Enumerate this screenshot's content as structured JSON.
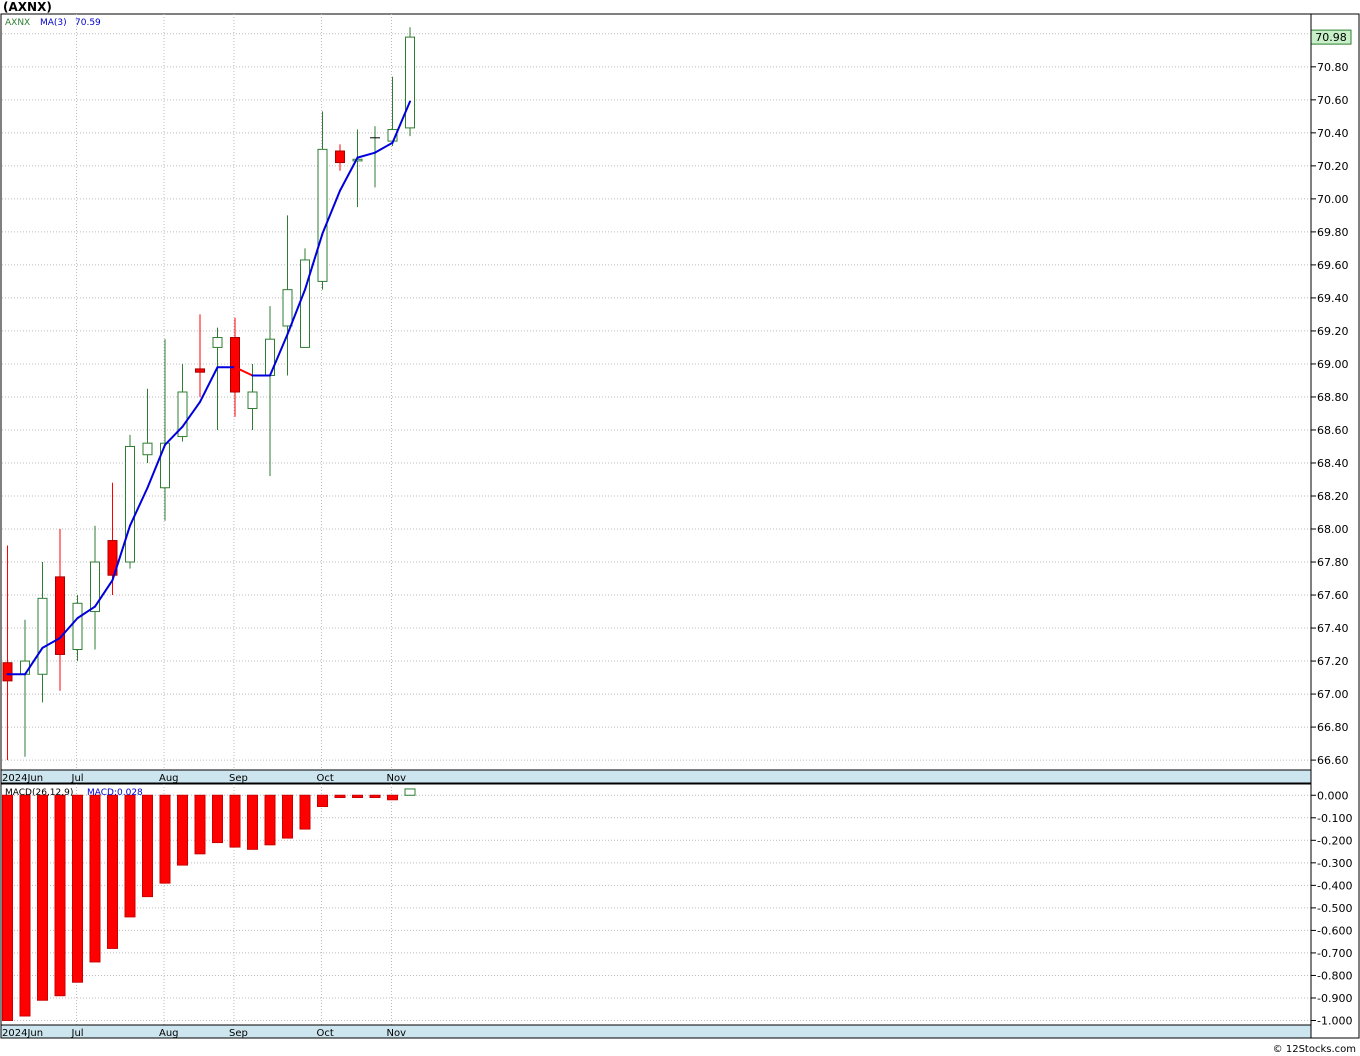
{
  "page": {
    "title": "(AXNX)",
    "footer": "© 12Stocks.com"
  },
  "colors": {
    "up_candle": "#2e7d32",
    "down_candle": "#ff0000",
    "ma_up": "#0000dd",
    "ma_down": "#ff0000",
    "date_band": "#cde5ee",
    "price_tag": "#c8f0c8",
    "macd_neg": "#ff0000",
    "macd_pos": "#2e7d32"
  },
  "chart_data": {
    "type": "candlestick",
    "price_panel": {
      "legend": {
        "symbol": "AXNX",
        "ma_label": "MA(3)",
        "ma_value": "70.59"
      },
      "last_price": "70.98",
      "ylim": [
        66.54,
        71.12
      ],
      "y_ticks": [
        "71.00",
        "70.80",
        "70.60",
        "70.40",
        "70.20",
        "70.00",
        "69.80",
        "69.60",
        "69.40",
        "69.20",
        "69.00",
        "68.80",
        "68.60",
        "68.40",
        "68.20",
        "68.00",
        "67.80",
        "67.60",
        "67.40",
        "67.20",
        "67.00",
        "66.80",
        "66.60"
      ],
      "x_labels": [
        {
          "label": "2024Jun",
          "index": 0
        },
        {
          "label": "Jul",
          "index": 4
        },
        {
          "label": "Aug",
          "index": 9
        },
        {
          "label": "Sep",
          "index": 13
        },
        {
          "label": "Oct",
          "index": 18
        },
        {
          "label": "Nov",
          "index": 22
        }
      ],
      "candles": [
        {
          "o": 67.19,
          "h": 67.9,
          "l": 66.6,
          "c": 67.08
        },
        {
          "o": 67.12,
          "h": 67.45,
          "l": 66.62,
          "c": 67.2
        },
        {
          "o": 67.12,
          "h": 67.8,
          "l": 66.95,
          "c": 67.58
        },
        {
          "o": 67.71,
          "h": 68.0,
          "l": 67.02,
          "c": 67.24
        },
        {
          "o": 67.27,
          "h": 67.6,
          "l": 67.2,
          "c": 67.55
        },
        {
          "o": 67.5,
          "h": 68.02,
          "l": 67.27,
          "c": 67.8
        },
        {
          "o": 67.93,
          "h": 68.28,
          "l": 67.6,
          "c": 67.72
        },
        {
          "o": 67.8,
          "h": 68.57,
          "l": 67.76,
          "c": 68.5
        },
        {
          "o": 68.45,
          "h": 68.85,
          "l": 68.4,
          "c": 68.52
        },
        {
          "o": 68.25,
          "h": 69.15,
          "l": 68.05,
          "c": 68.52
        },
        {
          "o": 68.56,
          "h": 69.0,
          "l": 68.53,
          "c": 68.83
        },
        {
          "o": 68.97,
          "h": 69.3,
          "l": 68.8,
          "c": 68.95
        },
        {
          "o": 69.1,
          "h": 69.22,
          "l": 68.6,
          "c": 69.16
        },
        {
          "o": 69.16,
          "h": 69.28,
          "l": 68.68,
          "c": 68.83
        },
        {
          "o": 68.73,
          "h": 69.0,
          "l": 68.6,
          "c": 68.83
        },
        {
          "o": 68.93,
          "h": 69.35,
          "l": 68.32,
          "c": 69.15
        },
        {
          "o": 69.23,
          "h": 69.9,
          "l": 68.93,
          "c": 69.45
        },
        {
          "o": 69.1,
          "h": 69.7,
          "l": 69.1,
          "c": 69.63
        },
        {
          "o": 69.5,
          "h": 70.53,
          "l": 69.45,
          "c": 70.3
        },
        {
          "o": 70.29,
          "h": 70.33,
          "l": 70.17,
          "c": 70.22
        },
        {
          "o": 70.23,
          "h": 70.42,
          "l": 69.95,
          "c": 70.24
        },
        {
          "o": 70.37,
          "h": 70.44,
          "l": 70.07,
          "c": 70.37
        },
        {
          "o": 70.35,
          "h": 70.74,
          "l": 70.32,
          "c": 70.42
        },
        {
          "o": 70.43,
          "h": 71.04,
          "l": 70.38,
          "c": 70.98
        }
      ],
      "ma3": [
        67.12,
        67.12,
        67.28,
        67.34,
        67.46,
        67.53,
        67.69,
        68.02,
        68.25,
        68.51,
        68.62,
        68.77,
        68.98,
        68.98,
        68.93,
        68.93,
        69.18,
        69.45,
        69.79,
        70.05,
        70.25,
        70.28,
        70.34,
        70.59
      ]
    },
    "macd_panel": {
      "label": "MACD(26,12,9)",
      "value_label": "MACD:0.028",
      "ylim": [
        -1.02,
        0.05
      ],
      "y_ticks": [
        "0.000",
        "-0.100",
        "-0.200",
        "-0.300",
        "-0.400",
        "-0.500",
        "-0.600",
        "-0.700",
        "-0.800",
        "-0.900",
        "-1.000"
      ],
      "x_labels": [
        {
          "label": "2024Jun",
          "index": 0
        },
        {
          "label": "Jul",
          "index": 4
        },
        {
          "label": "Aug",
          "index": 9
        },
        {
          "label": "Sep",
          "index": 13
        },
        {
          "label": "Oct",
          "index": 18
        },
        {
          "label": "Nov",
          "index": 22
        }
      ],
      "values": [
        -1.0,
        -0.98,
        -0.91,
        -0.89,
        -0.83,
        -0.74,
        -0.68,
        -0.54,
        -0.45,
        -0.39,
        -0.31,
        -0.26,
        -0.21,
        -0.23,
        -0.24,
        -0.22,
        -0.19,
        -0.15,
        -0.05,
        -0.01,
        -0.01,
        -0.01,
        -0.02,
        0.028
      ]
    }
  }
}
